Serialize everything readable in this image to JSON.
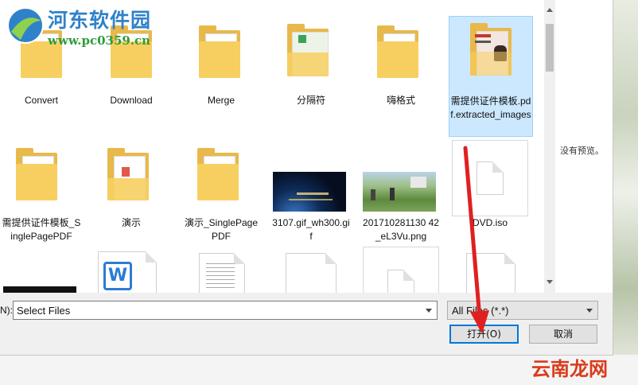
{
  "watermark": {
    "site_name": "河东软件园",
    "site_url": "www.pc0359.cn",
    "bottom_mark": "云南龙网"
  },
  "files": {
    "row1": [
      {
        "label": "Convert",
        "type": "folder"
      },
      {
        "label": "Download",
        "type": "folder"
      },
      {
        "label": "Merge",
        "type": "folder"
      },
      {
        "label": "分隔符",
        "type": "folder-preview"
      },
      {
        "label": "嗨格式",
        "type": "folder"
      },
      {
        "label": "需提供证件模板.pdf.extracted_images",
        "type": "folder-images",
        "selected": true
      }
    ],
    "row2": [
      {
        "label": "需提供证件模板_SinglePagePDF",
        "type": "folder"
      },
      {
        "label": "演示",
        "type": "folder-pdf"
      },
      {
        "label": "演示_SinglePagePDF",
        "type": "folder"
      },
      {
        "label": "3107.gif_wh300.gif",
        "type": "image-night"
      },
      {
        "label": "201710281130 42_eL3Vu.png",
        "type": "image-landscape"
      },
      {
        "label": "DVD.iso",
        "type": "file"
      }
    ],
    "row3": [
      {
        "label": "",
        "type": "black-bar"
      },
      {
        "label": "",
        "type": "word-doc"
      },
      {
        "label": "",
        "type": "text-doc"
      },
      {
        "label": "",
        "type": "file"
      },
      {
        "label": "",
        "type": "file"
      },
      {
        "label": "",
        "type": "file"
      }
    ]
  },
  "preview": {
    "no_preview": "没有预览。"
  },
  "footer": {
    "filename_label": "N):",
    "filename_value": "Select Files",
    "filter_value": "All Files (*.*)",
    "open_label": "打开(O)",
    "cancel_label": "取消"
  },
  "colors": {
    "selection": "#cce8ff",
    "accent": "#0078d7",
    "arrow": "#e02020",
    "folder": "#f7cf61"
  }
}
